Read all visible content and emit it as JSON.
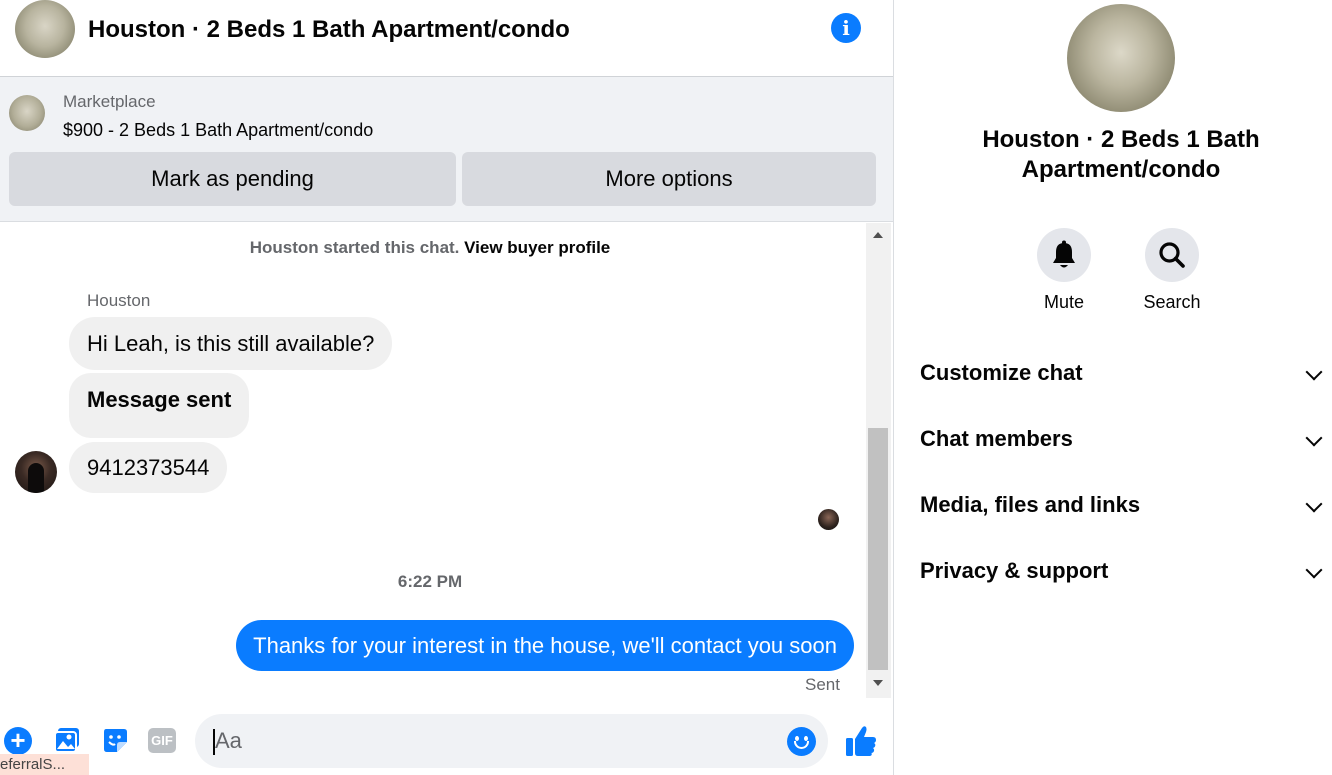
{
  "header": {
    "title": "Houston · 2 Beds 1 Bath Apartment/condo",
    "info_icon": "i"
  },
  "listing": {
    "source": "Marketplace",
    "price_title": "$900 - 2 Beds 1 Bath Apartment/condo",
    "pending_button": "Mark as pending",
    "more_button": "More options"
  },
  "thread": {
    "system_text": "Houston started this chat.",
    "system_link": "View buyer profile",
    "sender_name": "Houston",
    "messages_in": [
      "Hi Leah, is this still available?",
      "Message sent",
      "9412373544"
    ],
    "timestamp": "6:22 PM",
    "message_out": "Thanks for your interest in the house, we'll contact you soon",
    "status": "Sent"
  },
  "composer": {
    "placeholder": "Aa",
    "plus_glyph": "+",
    "gif_label": "GIF"
  },
  "tooltip": "eferralS...",
  "details": {
    "title": "Houston · 2 Beds 1 Bath Apartment/condo",
    "actions": {
      "mute": "Mute",
      "search": "Search"
    },
    "sections": [
      "Customize chat",
      "Chat members",
      "Media, files and links",
      "Privacy & support"
    ]
  },
  "colors": {
    "accent": "#0a7cff",
    "bubble_in": "#f0f0f0",
    "panel": "#f0f2f5",
    "button": "#d8dadf"
  }
}
